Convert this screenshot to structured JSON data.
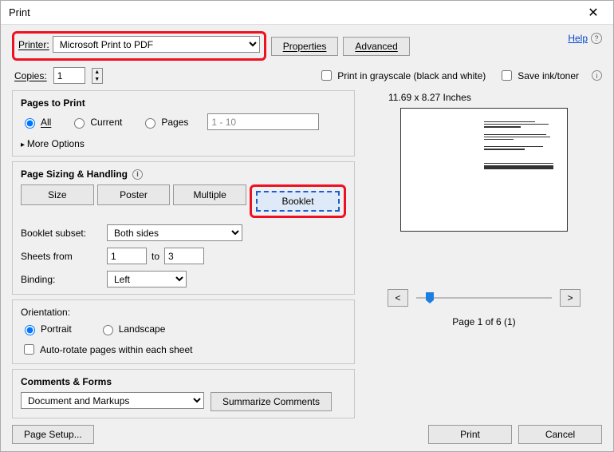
{
  "title": "Print",
  "printer": {
    "label": "Printer:",
    "selected": "Microsoft Print to PDF",
    "properties_btn": "Properties",
    "advanced_btn": "Advanced"
  },
  "help": "Help",
  "copies": {
    "label": "Copies:",
    "value": "1",
    "grayscale": "Print in grayscale (black and white)",
    "saveink": "Save ink/toner"
  },
  "pages_panel": {
    "heading": "Pages to Print",
    "all": "All",
    "current": "Current",
    "pages": "Pages",
    "range_placeholder": "1 - 10",
    "more": "More Options"
  },
  "sizing_panel": {
    "heading": "Page Sizing & Handling",
    "size": "Size",
    "poster": "Poster",
    "multiple": "Multiple",
    "booklet": "Booklet",
    "subset_label": "Booklet subset:",
    "subset_value": "Both sides",
    "sheets_from": "Sheets from",
    "sheets_from_val": "1",
    "to": "to",
    "sheets_to_val": "3",
    "binding_label": "Binding:",
    "binding_value": "Left"
  },
  "orientation_panel": {
    "heading": "Orientation:",
    "portrait": "Portrait",
    "landscape": "Landscape",
    "autorotate": "Auto-rotate pages within each sheet"
  },
  "comments_panel": {
    "heading": "Comments & Forms",
    "value": "Document and Markups",
    "summarize": "Summarize Comments"
  },
  "preview": {
    "dims": "11.69 x 8.27 Inches",
    "prev": "<",
    "next": ">",
    "pageof": "Page 1 of 6 (1)"
  },
  "footer": {
    "page_setup": "Page Setup...",
    "print": "Print",
    "cancel": "Cancel"
  }
}
